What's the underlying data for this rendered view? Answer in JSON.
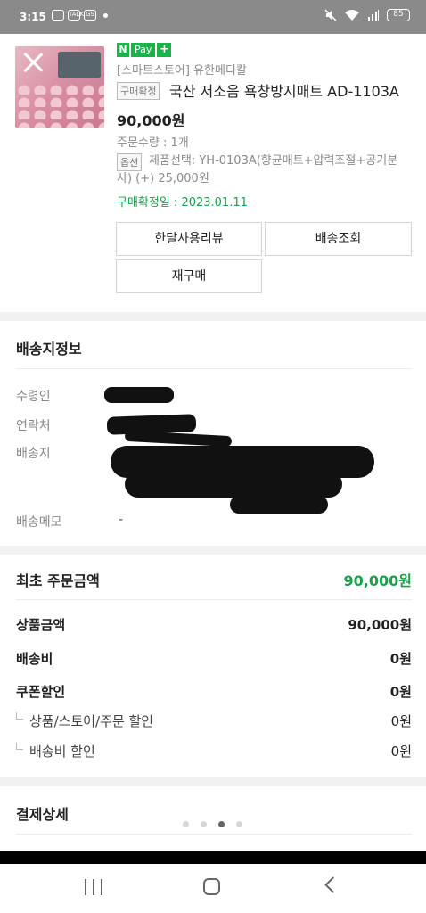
{
  "status_bar": {
    "time": "3:15",
    "left_icon_labels": [
      "TALK",
      "GS"
    ],
    "battery": "85"
  },
  "product": {
    "npay_n": "N",
    "npay_pay": "Pay",
    "npay_plus": "+",
    "store": "[스마트스토어] 유한메디칼",
    "status": "구매확정",
    "name": "국산 저소음 욕창방지매트 AD-1103A",
    "price": "90,000원",
    "quantity": "주문수량 : 1개",
    "option_chip": "옵션",
    "option_text": "제품선택: YH-0103A(향균매트+압력조절+공기분사) (+) 25,000원",
    "confirm_date": "구매확정일 : 2023.01.11",
    "buttons": {
      "review": "한달사용리뷰",
      "track": "배송조회",
      "rebuy": "재구매"
    }
  },
  "delivery": {
    "title": "배송지정보",
    "labels": {
      "recipient": "수령인",
      "contact": "연락처",
      "address": "배송지",
      "memo": "배송메모"
    },
    "memo_value": "-"
  },
  "amounts": {
    "initial_label": "최초 주문금액",
    "initial_value": "90,000원",
    "product_label": "상품금액",
    "product_value": "90,000원",
    "shipping_label": "배송비",
    "shipping_value": "0원",
    "coupon_label": "쿠폰할인",
    "coupon_value": "0원",
    "store_discount_label": "상품/스토어/주문 할인",
    "store_discount_value": "0원",
    "shipping_discount_label": "배송비 할인",
    "shipping_discount_value": "0원"
  },
  "payment": {
    "title": "결제상세"
  },
  "pager": {
    "count": 4,
    "active_index": 2
  },
  "colors": {
    "accent_green": "#19a04a",
    "npay_green": "#19b24b",
    "status_bar_gray": "#8a8a8a"
  },
  "icons": [
    "close-icon",
    "npay-logo",
    "mute-icon",
    "wifi-icon",
    "signal-icon",
    "battery-icon",
    "recents-icon",
    "home-icon",
    "back-icon"
  ]
}
